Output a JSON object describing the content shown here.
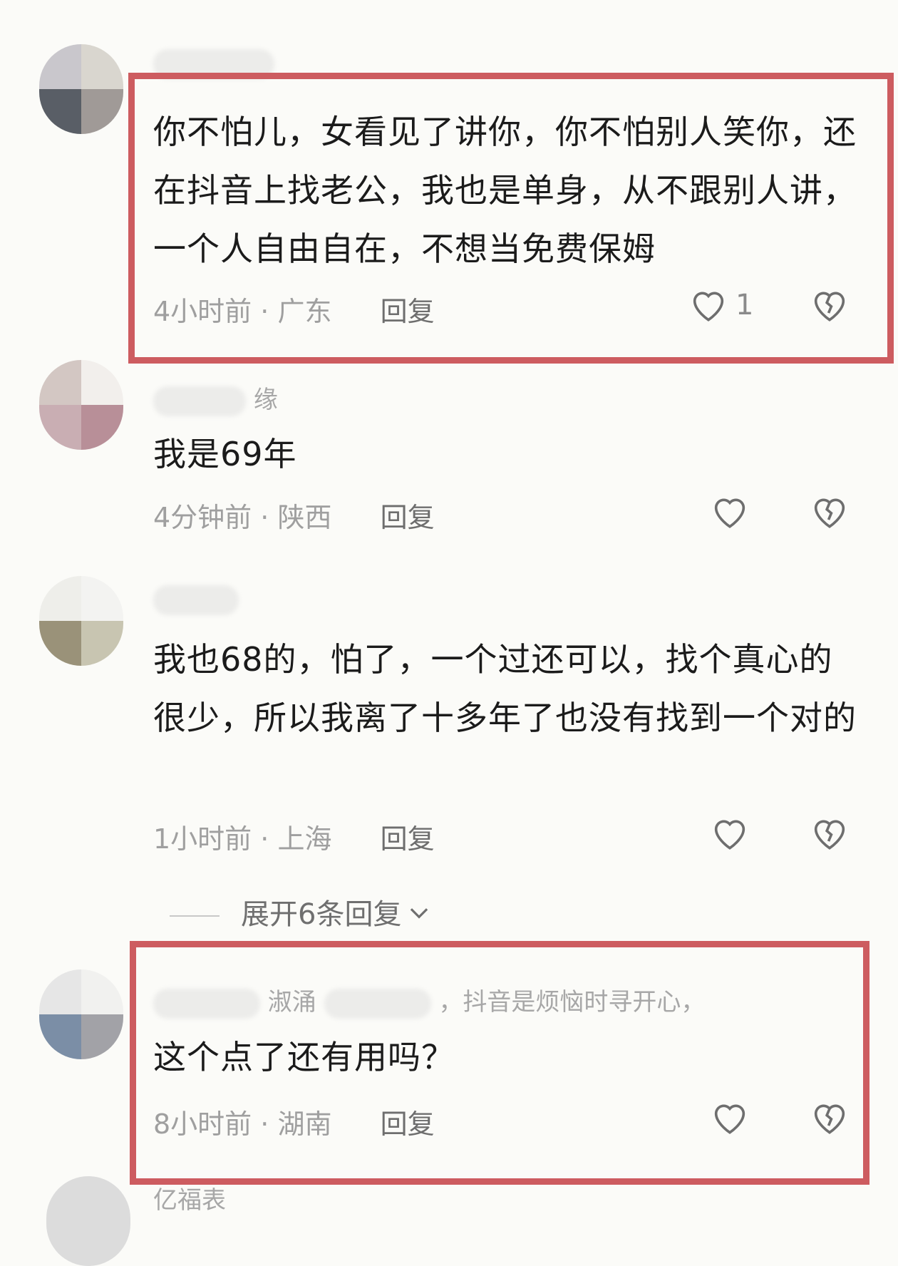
{
  "comments": [
    {
      "username": "",
      "text": "你不怕儿，女看见了讲你，你不怕别人笑你，还在抖音上找老公，我也是单身，从不跟别人讲，一个人自由自在，不想当免费保姆",
      "time": "4小时前",
      "location": "广东",
      "separator": "·",
      "reply": "回复",
      "likes": "1",
      "highlighted": true,
      "avatar_colors": [
        "#c9c7cc",
        "#d9d6cf",
        "#595e66",
        "#a09a97"
      ]
    },
    {
      "username": "缘",
      "text": "我是69年",
      "time": "4分钟前",
      "location": "陕西",
      "separator": "·",
      "reply": "回复",
      "highlighted": false,
      "avatar_colors": [
        "#d3c7c3",
        "#f2efec",
        "#c9aeb3",
        "#b88f98"
      ]
    },
    {
      "username": "",
      "text": "我也68的，怕了，一个过还可以，找个真心的很少，所以我离了十多年了也没有找到一个对的",
      "time": "1小时前",
      "location": "上海",
      "separator": "·",
      "reply": "回复",
      "highlighted": false,
      "avatar_colors": [
        "#eeeeea",
        "#f3f3f1",
        "#9a9279",
        "#c8c5b1"
      ]
    },
    {
      "username": "淑涌",
      "username_suffix": "，抖音是烦恼时寻开心，",
      "text": "这个点了还有用吗？",
      "time": "8小时前",
      "location": "湖南",
      "separator": "·",
      "reply": "回复",
      "highlighted": true,
      "avatar_colors": [
        "#e6e6e6",
        "#f1f1ef",
        "#7b8ea6",
        "#a2a2a7"
      ]
    }
  ],
  "expand_replies": "展开6条回复",
  "next_username_partial": "亿福表"
}
